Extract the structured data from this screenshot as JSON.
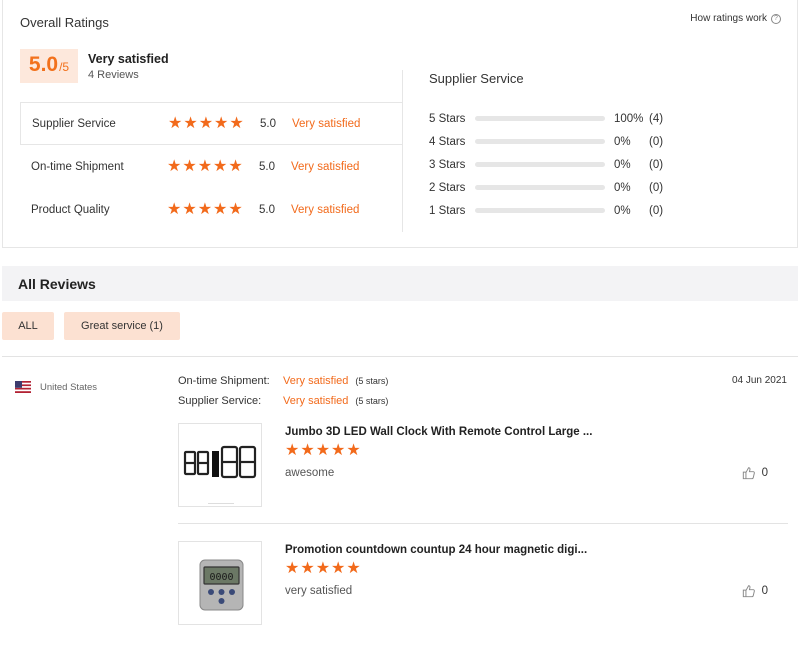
{
  "overall": {
    "title": "Overall Ratings",
    "how_ratings": "How ratings work",
    "score": "5.0",
    "score_denominator": "/5",
    "satisfaction": "Very satisfied",
    "review_count": "4 Reviews"
  },
  "ratings": [
    {
      "label": "Supplier Service",
      "stars": 5,
      "score": "5.0",
      "satisfaction": "Very satisfied"
    },
    {
      "label": "On-time Shipment",
      "stars": 5,
      "score": "5.0",
      "satisfaction": "Very satisfied"
    },
    {
      "label": "Product Quality",
      "stars": 5,
      "score": "5.0",
      "satisfaction": "Very satisfied"
    }
  ],
  "supplier_service": {
    "title": "Supplier Service",
    "distribution": [
      {
        "label": "5 Stars",
        "fraction": 1.0,
        "pct": "100%",
        "count": "(4)"
      },
      {
        "label": "4 Stars",
        "fraction": 0,
        "pct": "0%",
        "count": "(0)"
      },
      {
        "label": "3 Stars",
        "fraction": 0,
        "pct": "0%",
        "count": "(0)"
      },
      {
        "label": "2 Stars",
        "fraction": 0,
        "pct": "0%",
        "count": "(0)"
      },
      {
        "label": "1 Stars",
        "fraction": 0,
        "pct": "0%",
        "count": "(0)"
      }
    ]
  },
  "all_reviews": {
    "title": "All Reviews",
    "filters": {
      "all": "ALL",
      "great_service": "Great service (1)"
    }
  },
  "review": {
    "country": "United States",
    "date": "04 Jun 2021",
    "shipment_label": "On-time Shipment:",
    "shipment_value": "Very satisfied",
    "shipment_stars": "(5 stars)",
    "service_label": "Supplier Service:",
    "service_value": "Very satisfied",
    "service_stars": "(5 stars)",
    "products": [
      {
        "name": "Jumbo 3D LED Wall Clock With Remote Control Large ...",
        "stars": 5,
        "comment": "awesome",
        "likes": "0",
        "icon": "led-clock-image"
      },
      {
        "name": "Promotion countdown countup 24 hour magnetic digi...",
        "stars": 5,
        "comment": "very satisfied",
        "likes": "0",
        "icon": "kitchen-timer-image"
      }
    ]
  },
  "colors": {
    "accent": "#f26a1b",
    "score_bg": "#fde8dc",
    "filter_bg": "#fce1d2"
  }
}
